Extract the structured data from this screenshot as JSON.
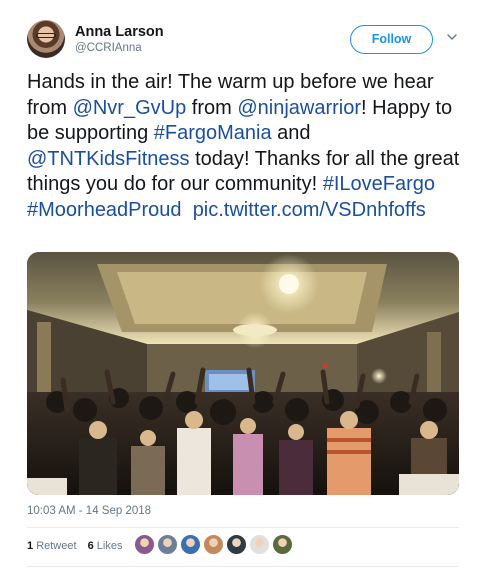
{
  "user": {
    "display_name": "Anna Larson",
    "handle": "@CCRIAnna"
  },
  "follow_label": "Follow",
  "tweet": {
    "segments": [
      {
        "text": "Hands in the air! The warm up before we hear from ",
        "link": false
      },
      {
        "text": "@Nvr_GvUp",
        "link": true
      },
      {
        "text": " from ",
        "link": false
      },
      {
        "text": "@ninjawarrior",
        "link": true
      },
      {
        "text": "! Happy to be supporting ",
        "link": false
      },
      {
        "text": "#FargoMania",
        "link": true
      },
      {
        "text": " and ",
        "link": false
      },
      {
        "text": "@TNTKidsFitness",
        "link": true
      },
      {
        "text": " today! Thanks for all the great things you do for our community! ",
        "link": false
      },
      {
        "text": "#ILoveFargo",
        "link": true
      },
      {
        "text": " ",
        "link": false
      },
      {
        "text": "#MoorheadProud",
        "link": true
      },
      {
        "text": "  ",
        "link": false
      },
      {
        "text": "pic.twitter.com/VSDnhfoffs",
        "link": true
      }
    ]
  },
  "timestamp": "10:03 AM - 14 Sep 2018",
  "stats": {
    "retweet_count": "1",
    "retweet_label": "Retweet",
    "like_count": "6",
    "like_label": "Likes"
  },
  "likers": [
    {
      "name": "liker-1",
      "color": "#8a5a8c"
    },
    {
      "name": "liker-2",
      "color": "#6b7f9a"
    },
    {
      "name": "liker-3",
      "color": "#3a6fb0"
    },
    {
      "name": "liker-4",
      "color": "#c48a5c"
    },
    {
      "name": "liker-5",
      "color": "#2f3b44"
    },
    {
      "name": "liker-6",
      "color": "#e0e0e0"
    },
    {
      "name": "liker-7",
      "color": "#5a6a3a"
    }
  ]
}
